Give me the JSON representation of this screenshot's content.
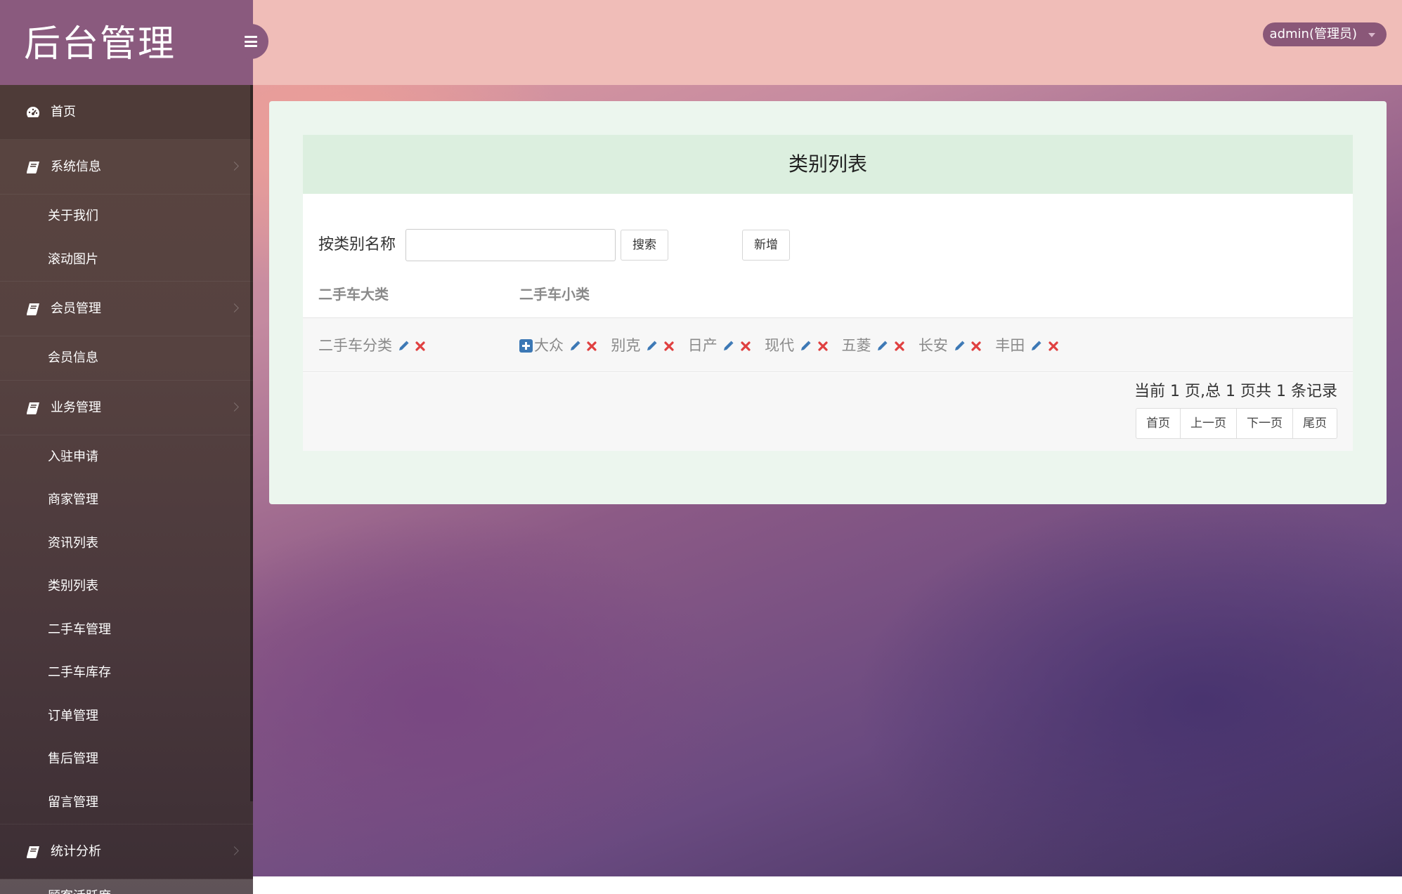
{
  "brand": {
    "title": "后台管理"
  },
  "header": {
    "user_label": "admin(管理员)"
  },
  "sidebar": {
    "home": "首页",
    "groups": [
      {
        "label": "系统信息",
        "items": [
          "关于我们",
          "滚动图片"
        ]
      },
      {
        "label": "会员管理",
        "items": [
          "会员信息"
        ]
      },
      {
        "label": "业务管理",
        "items": [
          "入驻申请",
          "商家管理",
          "资讯列表",
          "类别列表",
          "二手车管理",
          "二手车库存",
          "订单管理",
          "售后管理",
          "留言管理"
        ]
      },
      {
        "label": "统计分析",
        "items": [
          "顾客活跃度"
        ]
      }
    ]
  },
  "main": {
    "card_title": "类别列表",
    "search": {
      "label": "按类别名称",
      "value": "",
      "placeholder": ""
    },
    "buttons": {
      "search": "搜索",
      "add": "新增"
    },
    "table": {
      "headers": [
        "二手车大类",
        "二手车小类"
      ],
      "rows": [
        {
          "category": "二手车分类",
          "subcategories": [
            "大众",
            "别克",
            "日产",
            "现代",
            "五菱",
            "长安",
            "丰田"
          ]
        }
      ]
    },
    "pagination": {
      "info": "当前 1 页,总 1 页共 1 条记录",
      "first": "首页",
      "prev": "上一页",
      "next": "下一页",
      "last": "尾页"
    }
  },
  "colors": {
    "brand_bg": "#8a5a7e",
    "topbar_bg": "#f0bdb8",
    "card_head_bg": "#dcefdf",
    "edit_icon": "#3c78b5",
    "delete_icon": "#e04040"
  },
  "icons": {
    "menu_toggle": "bars-icon",
    "home": "dashboard-icon",
    "group": "book-icon",
    "edit": "pencil-icon",
    "delete": "times-icon",
    "add_sub": "plus-square-icon"
  }
}
